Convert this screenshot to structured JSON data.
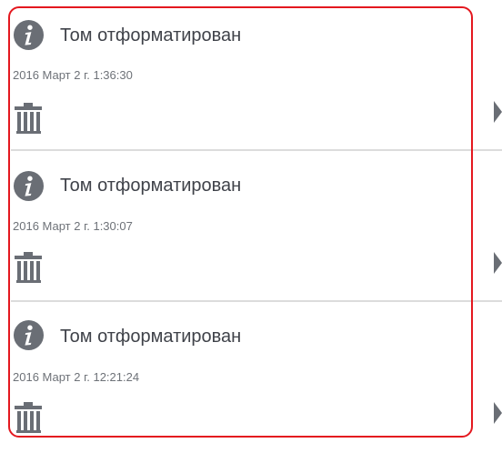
{
  "events": [
    {
      "title": "Том отформатирован",
      "timestamp": "2016 Март 2 г. 1:36:30",
      "icon": "info-icon",
      "action_icon": "trash-icon",
      "expand_icon": "chevron-right-icon"
    },
    {
      "title": "Том отформатирован",
      "timestamp": "2016 Март 2 г. 1:30:07",
      "icon": "info-icon",
      "action_icon": "trash-icon",
      "expand_icon": "chevron-right-icon"
    },
    {
      "title": "Том отформатирован",
      "timestamp": "2016 Март 2 г. 12:21:24",
      "icon": "info-icon",
      "action_icon": "trash-icon",
      "expand_icon": "chevron-right-icon"
    }
  ],
  "colors": {
    "icon_gray": "#6a6e75",
    "title_text": "#3f4249",
    "timestamp_text": "#6e7278",
    "divider": "#dcdcdc",
    "highlight_border": "#e4181f"
  }
}
